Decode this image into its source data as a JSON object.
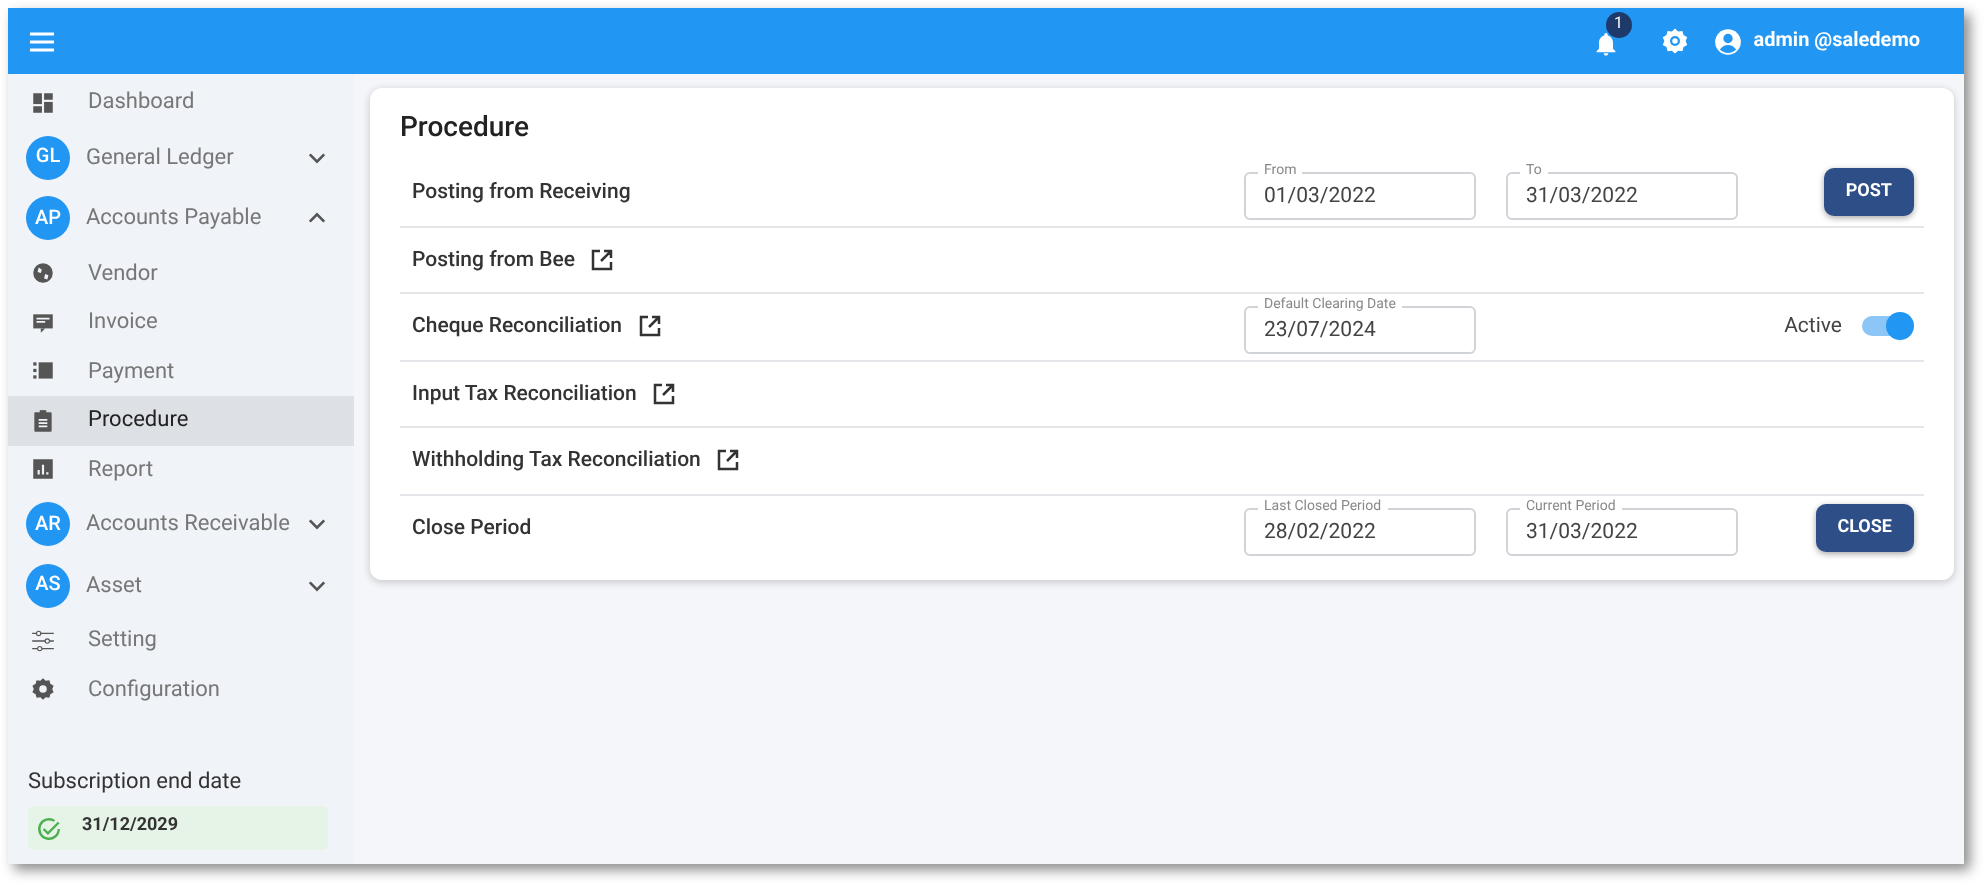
{
  "top_bar": {
    "notification_count": "1",
    "user": "admin @saledemo"
  },
  "sidebar": {
    "items": [
      {
        "kind": "link",
        "label": "Dashboard",
        "selected": false
      },
      {
        "kind": "group",
        "avatar": "GL",
        "label": "General Ledger",
        "expanded": false
      },
      {
        "kind": "group",
        "avatar": "AP",
        "label": "Accounts Payable",
        "expanded": true
      },
      {
        "kind": "link",
        "label": "Vendor",
        "selected": false
      },
      {
        "kind": "link",
        "label": "Invoice",
        "selected": false
      },
      {
        "kind": "link",
        "label": "Payment",
        "selected": false
      },
      {
        "kind": "link",
        "label": "Procedure",
        "selected": true
      },
      {
        "kind": "link",
        "label": "Report",
        "selected": false
      },
      {
        "kind": "group",
        "avatar": "AR",
        "label": "Accounts Receivable",
        "expanded": false
      },
      {
        "kind": "group",
        "avatar": "AS",
        "label": "Asset",
        "expanded": false
      },
      {
        "kind": "link",
        "label": "Setting",
        "selected": false
      },
      {
        "kind": "link",
        "label": "Configuration",
        "selected": false
      }
    ],
    "subscription": {
      "label": "Subscription end date",
      "date": "31/12/2029"
    }
  },
  "procedure": {
    "title": "Procedure",
    "rows": [
      {
        "label": "Posting from Receiving",
        "external_link": false,
        "fields": [
          {
            "label": "From",
            "value": "01/03/2022"
          },
          {
            "label": "To",
            "value": "31/03/2022"
          }
        ],
        "button": "POST"
      },
      {
        "label": "Posting from Bee",
        "external_link": true
      },
      {
        "label": "Cheque Reconciliation",
        "external_link": true,
        "fields": [
          {
            "label": "Default Clearing Date",
            "value": "23/07/2024"
          }
        ],
        "toggle": {
          "label": "Active",
          "on": true
        }
      },
      {
        "label": "Input Tax Reconciliation",
        "external_link": true
      },
      {
        "label": "Withholding Tax Reconciliation",
        "external_link": true
      },
      {
        "label": "Close Period",
        "external_link": false,
        "fields": [
          {
            "label": "Last Closed Period",
            "value": "28/02/2022"
          },
          {
            "label": "Current Period",
            "value": "31/03/2022"
          }
        ],
        "button": "CLOSE"
      }
    ]
  }
}
